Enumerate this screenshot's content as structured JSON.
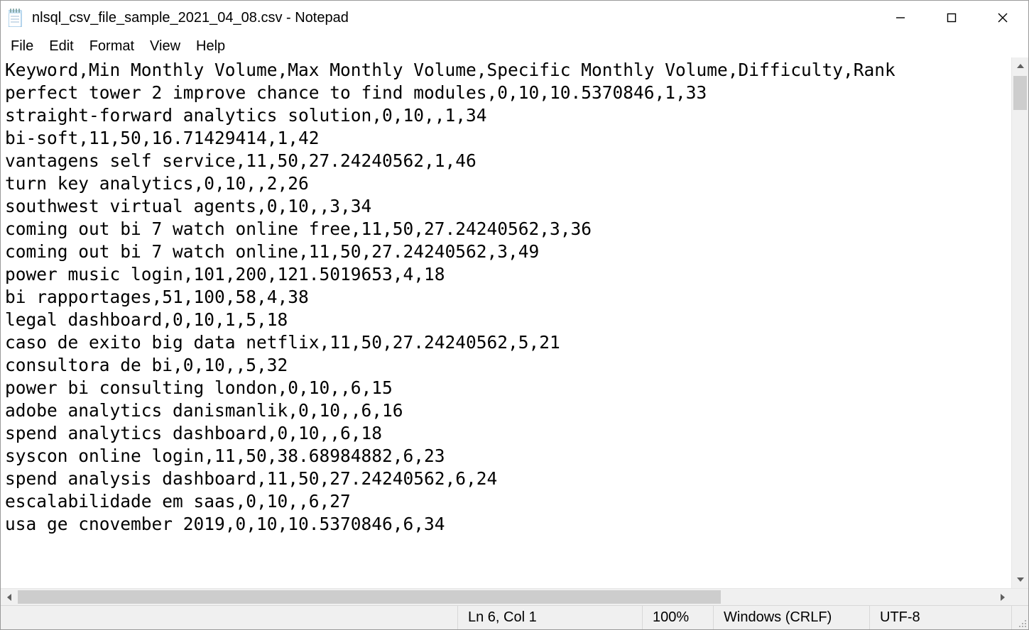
{
  "window": {
    "title": "nlsql_csv_file_sample_2021_04_08.csv - Notepad"
  },
  "menu": {
    "file": "File",
    "edit": "Edit",
    "format": "Format",
    "view": "View",
    "help": "Help"
  },
  "document": {
    "text": "Keyword,Min Monthly Volume,Max Monthly Volume,Specific Monthly Volume,Difficulty,Rank\nperfect tower 2 improve chance to find modules,0,10,10.5370846,1,33\nstraight-forward analytics solution,0,10,,1,34\nbi-soft,11,50,16.71429414,1,42\nvantagens self service,11,50,27.24240562,1,46\nturn key analytics,0,10,,2,26\nsouthwest virtual agents,0,10,,3,34\ncoming out bi 7 watch online free,11,50,27.24240562,3,36\ncoming out bi 7 watch online,11,50,27.24240562,3,49\npower music login,101,200,121.5019653,4,18\nbi rapportages,51,100,58,4,38\nlegal dashboard,0,10,1,5,18\ncaso de exito big data netflix,11,50,27.24240562,5,21\nconsultora de bi,0,10,,5,32\npower bi consulting london,0,10,,6,15\nadobe analytics danismanlik,0,10,,6,16\nspend analytics dashboard,0,10,,6,18\nsyscon online login,11,50,38.68984882,6,23\nspend analysis dashboard,11,50,27.24240562,6,24\nescalabilidade em saas,0,10,,6,27\nusa ge cnovember 2019,0,10,10.5370846,6,34"
  },
  "status": {
    "position": "Ln 6, Col 1",
    "zoom": "100%",
    "line_ending": "Windows (CRLF)",
    "encoding": "UTF-8"
  }
}
